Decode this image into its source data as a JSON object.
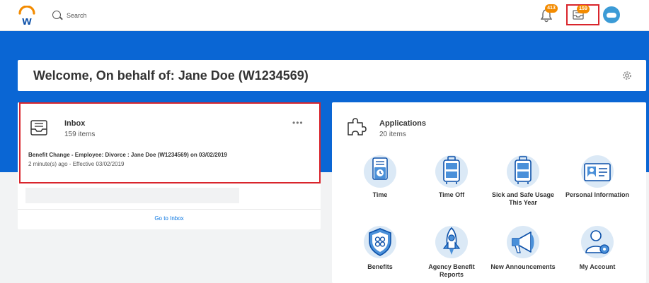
{
  "header": {
    "logo_letter": "w",
    "search_placeholder": "Search",
    "notifications_count": "413",
    "inbox_count": "159"
  },
  "welcome": {
    "title": "Welcome, On behalf of: Jane Doe (W1234569)"
  },
  "inbox": {
    "title": "Inbox",
    "count": "159 items",
    "task_title": "Benefit Change - Employee: Divorce : Jane Doe (W1234569) on 03/02/2019",
    "task_meta": "2 minute(s) ago - Effective 03/02/2019",
    "go_to_label": "Go to Inbox"
  },
  "applications": {
    "title": "Applications",
    "count": "20 items",
    "apps": [
      {
        "label": "Time",
        "icon": "clock-icon"
      },
      {
        "label": "Time Off",
        "icon": "suitcase-icon"
      },
      {
        "label": "Sick and Safe Usage This Year",
        "icon": "suitcase-icon"
      },
      {
        "label": "Personal Information",
        "icon": "id-card-icon"
      },
      {
        "label": "Benefits",
        "icon": "shield-icon"
      },
      {
        "label": "Agency Benefit Reports",
        "icon": "rocket-icon"
      },
      {
        "label": "New Announcements",
        "icon": "megaphone-icon"
      },
      {
        "label": "My Account",
        "icon": "person-gear-icon"
      }
    ]
  },
  "colors": {
    "brand_blue": "#0a66d4",
    "badge_orange": "#f38b00",
    "highlight_red": "#d9252c",
    "link_blue": "#0875e1"
  }
}
